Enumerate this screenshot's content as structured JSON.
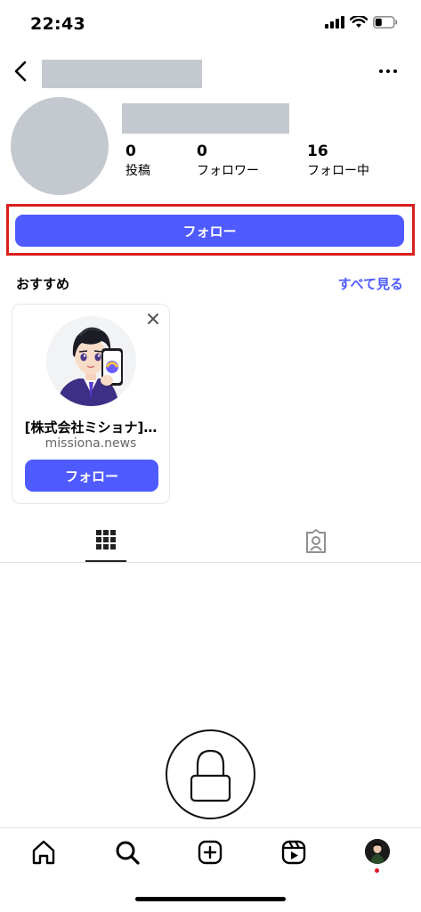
{
  "status_bar": {
    "time": "22:43"
  },
  "profile": {
    "stats": [
      {
        "value": "0",
        "label": "投稿"
      },
      {
        "value": "0",
        "label": "フォロワー"
      },
      {
        "value": "16",
        "label": "フォロー中"
      }
    ],
    "follow_label": "フォロー"
  },
  "suggestions": {
    "title": "おすすめ",
    "see_all": "すべて見る",
    "card": {
      "name": "[株式会社ミショナ]…",
      "subtitle": "missiona.news",
      "follow_label": "フォロー"
    }
  },
  "colors": {
    "accent": "#4f5bff",
    "highlight": "#d9201f",
    "placeholder": "#c4c8cf"
  },
  "icons": [
    "back-arrow-icon",
    "more-icon",
    "close-icon",
    "grid-icon",
    "tagged-icon",
    "lock-icon",
    "home-icon",
    "search-icon",
    "create-icon",
    "reels-icon"
  ]
}
